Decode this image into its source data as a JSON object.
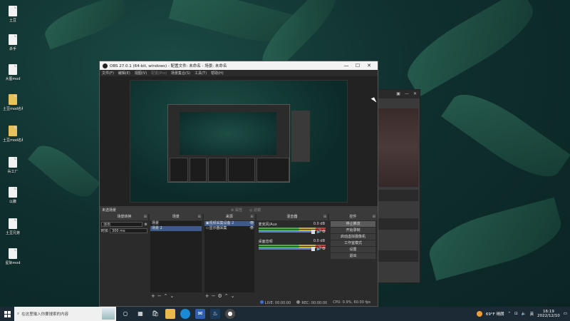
{
  "desktop": {
    "icons": [
      {
        "label": "土豆"
      },
      {
        "label": "杀手"
      },
      {
        "label": "大图mod"
      },
      {
        "label": "土豆mod名称数值"
      },
      {
        "label": "土豆mod名称数值改"
      },
      {
        "label": "兵工厂"
      },
      {
        "label": "以撒"
      },
      {
        "label": "土豆兄弟"
      },
      {
        "label": "星际mod"
      }
    ]
  },
  "obs": {
    "window_title": "OBS 27.0.1 (64-bit, windows) - 配置文件: 未命名 - 场景: 未命名",
    "window_controls": {
      "minimize": "—",
      "maximize": "☐",
      "close": "✕"
    },
    "menu": [
      "文件(F)",
      "编辑(E)",
      "视图(V)",
      "配置(Pro)",
      "场景集合(S)",
      "工具(T)",
      "帮助(H)"
    ],
    "scene_bar": {
      "label": "未选场景",
      "left_toggle": "属性",
      "right_toggle": "滤镜"
    },
    "docks": {
      "scenes": {
        "title": "场景",
        "items": [
          "场景",
          "场景 2"
        ],
        "selected_index": 1
      },
      "filters": {
        "title": "场景转换",
        "transition": "淡出",
        "duration_label": "时长",
        "duration": "300 ms"
      },
      "sources": {
        "title": "来源",
        "items": [
          "视频采集设备 2",
          "显示器采集"
        ]
      },
      "mixer": {
        "title": "混音器",
        "channels": [
          {
            "name": "麦克风/Aux",
            "db": "0.0 dB"
          },
          {
            "name": "桌面音频",
            "db": "0.0 dB"
          }
        ]
      },
      "controls": {
        "title": "控件",
        "buttons": [
          "停止推流",
          "开始录制",
          "启动虚拟摄像机",
          "工作室模式",
          "设置",
          "退出"
        ],
        "active_index": 0
      }
    },
    "status": {
      "live": "LIVE: 00:00:00",
      "rec": "REC: 00:00:00",
      "cpu": "CPU: 0.9%, 60.00 fps"
    }
  },
  "taskbar": {
    "search_placeholder": "在这里输入你要搜索的内容",
    "weather": "69°F 晴朗",
    "ime": "英",
    "time": "16:19",
    "date": "2022/12/10"
  },
  "colors": {
    "accent": "#3d5a8a",
    "desktop": "#0f2f2e"
  }
}
